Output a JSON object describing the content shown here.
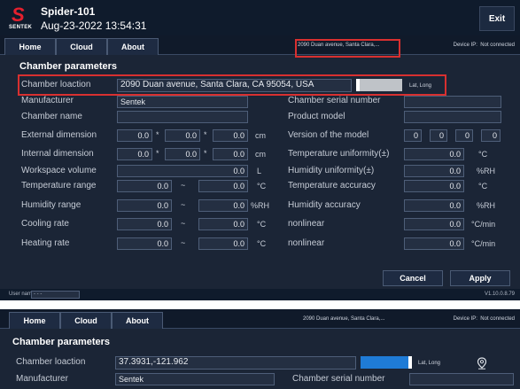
{
  "window": {
    "app_title": "Spider-101",
    "datetime": "Aug-23-2022 13:54:31",
    "logo_letter": "S",
    "brand": "SENTEK",
    "exit_label": "Exit"
  },
  "nav": {
    "tabs": [
      "Home",
      "Cloud",
      "About"
    ],
    "address": "2090 Duan avenue, Santa Clara,...",
    "device_ip_label": "Device IP:",
    "device_ip_value": "Not connected"
  },
  "section_title": "Chamber parameters",
  "fields": {
    "chamber_location": {
      "label": "Chamber loaction",
      "value": "2090 Duan avenue, Santa Clara, CA 95054, USA"
    },
    "lat_long_label": "Lat, Long",
    "manufacturer": {
      "label": "Manufacturer",
      "value": "Sentek"
    },
    "chamber_serial_number": {
      "label": "Chamber serial number",
      "value": ""
    },
    "chamber_name": {
      "label": "Chamber name",
      "value": ""
    },
    "product_model": {
      "label": "Product model",
      "value": ""
    },
    "external_dimension": {
      "label": "External dimension",
      "values": [
        "0.0",
        "0.0",
        "0.0"
      ],
      "separator": "*",
      "unit": "cm"
    },
    "version_of_model": {
      "label": "Version of the model",
      "values": [
        "0",
        "0",
        "0",
        "0"
      ]
    },
    "internal_dimension": {
      "label": "Internal dimension",
      "values": [
        "0.0",
        "0.0",
        "0.0"
      ],
      "separator": "*",
      "unit": "cm"
    },
    "temperature_uniformity": {
      "label": "Temperature uniformity(±)",
      "value": "0.0",
      "unit": "°C"
    },
    "workspace_volume": {
      "label": "Workspace volume",
      "value": "0.0",
      "unit": "L"
    },
    "humidity_uniformity": {
      "label": "Humidity uniformity(±)",
      "value": "0.0",
      "unit": "%RH"
    },
    "temperature_range": {
      "label": "Temperature range",
      "min": "0.0",
      "max": "0.0",
      "separator": "~",
      "unit": "°C"
    },
    "temperature_accuracy": {
      "label": "Temperature accuracy",
      "value": "0.0",
      "unit": "°C"
    },
    "humidity_range": {
      "label": "Humidity range",
      "min": "0.0",
      "max": "0.0",
      "separator": "~",
      "unit": "%RH"
    },
    "humidity_accuracy": {
      "label": "Humidity accuracy",
      "value": "0.0",
      "unit": "%RH"
    },
    "cooling_rate": {
      "label": "Cooling rate",
      "min": "0.0",
      "max": "0.0",
      "separator": "~",
      "unit": "°C"
    },
    "nonlinear_1": {
      "label": "nonlinear",
      "value": "0.0",
      "unit": "°C/min"
    },
    "heating_rate": {
      "label": "Heating rate",
      "min": "0.0",
      "max": "0.0",
      "separator": "~",
      "unit": "°C"
    },
    "nonlinear_2": {
      "label": "nonlinear",
      "value": "0.0",
      "unit": "°C/min"
    }
  },
  "buttons": {
    "cancel": "Cancel",
    "apply": "Apply"
  },
  "statusbar": {
    "user_label": "User name:",
    "user_value": "- - -",
    "version": "V1.10.0.8.79"
  },
  "second_view": {
    "address": "2090 Duan avenue, Santa Clara,...",
    "device_ip_label": "Device IP:",
    "device_ip_value": "Not connected",
    "section_title": "Chamber parameters",
    "chamber_location": {
      "label": "Chamber loaction",
      "value": "37.3931,-121.962"
    },
    "lat_long_label": "Lat, Long",
    "manufacturer": {
      "label": "Manufacturer",
      "value": "Sentek"
    },
    "chamber_serial_number": {
      "label": "Chamber serial number",
      "value": ""
    }
  },
  "colors": {
    "background": "#1b2536",
    "highlight": "#d83030",
    "lat_long_active": "#1f7bd6",
    "logo_red": "#e5202e"
  }
}
